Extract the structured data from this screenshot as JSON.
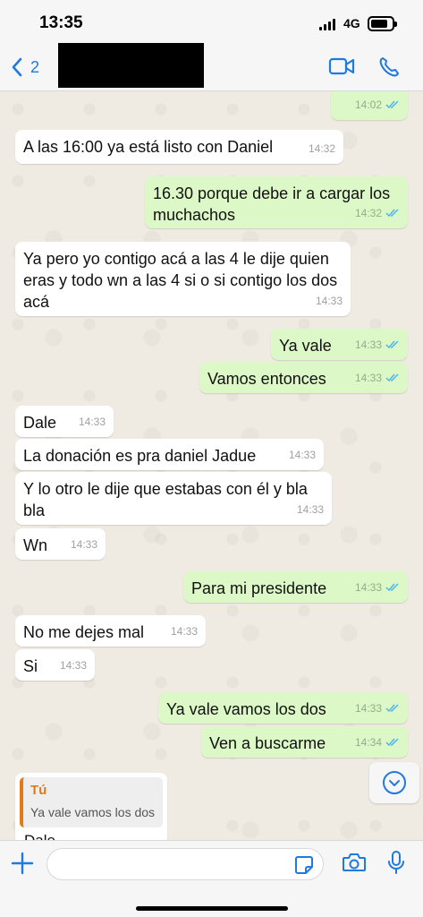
{
  "status_bar": {
    "time": "13:35",
    "network": "4G"
  },
  "header": {
    "back_count": "2"
  },
  "messages": [
    {
      "dir": "out",
      "text": "",
      "time": "14:02",
      "read": true
    },
    {
      "dir": "in",
      "text": "A las 16:00 ya está listo con Daniel",
      "time": "14:32"
    },
    {
      "dir": "out",
      "text": "16.30 porque debe ir a cargar los muchachos",
      "time": "14:32",
      "read": true
    },
    {
      "dir": "in",
      "text": "Ya pero yo contigo acá a las 4 le dije quien eras y todo wn a las 4 si o si contigo los dos acá",
      "time": "14:33"
    },
    {
      "dir": "out",
      "text": "Ya vale",
      "time": "14:33",
      "read": true
    },
    {
      "dir": "out",
      "text": "Vamos entonces",
      "time": "14:33",
      "read": true
    },
    {
      "dir": "in",
      "text": "Dale",
      "time": "14:33"
    },
    {
      "dir": "in",
      "text": "La donación es pra daniel Jadue",
      "time": "14:33"
    },
    {
      "dir": "in",
      "text": "Y lo otro le dije que estabas con él y bla bla",
      "time": "14:33"
    },
    {
      "dir": "in",
      "text": "Wn",
      "time": "14:33"
    },
    {
      "dir": "out",
      "text": "Para mi presidente",
      "time": "14:33",
      "read": true
    },
    {
      "dir": "in",
      "text": "No me dejes mal",
      "time": "14:33"
    },
    {
      "dir": "in",
      "text": "Si",
      "time": "14:33"
    },
    {
      "dir": "out",
      "text": "Ya vale vamos los dos",
      "time": "14:33",
      "read": true
    },
    {
      "dir": "out",
      "text": "Ven a buscarme",
      "time": "14:34",
      "read": true
    }
  ],
  "reply_preview": {
    "author": "Tú",
    "quoted_text": "Ya vale vamos los dos",
    "body": "Dale"
  },
  "composer": {
    "placeholder": ""
  },
  "colors": {
    "accent": "#1f7ae0",
    "bubble_out": "#dcf8c6",
    "bubble_in": "#ffffff",
    "read_ticks": "#4fb6ec",
    "quote_author": "#e07b1a",
    "chat_bg": "#efeae2"
  },
  "icons": [
    "back-chevron-icon",
    "video-call-icon",
    "phone-icon",
    "chevron-down-icon",
    "plus-icon",
    "sticker-icon",
    "camera-icon",
    "mic-icon"
  ]
}
